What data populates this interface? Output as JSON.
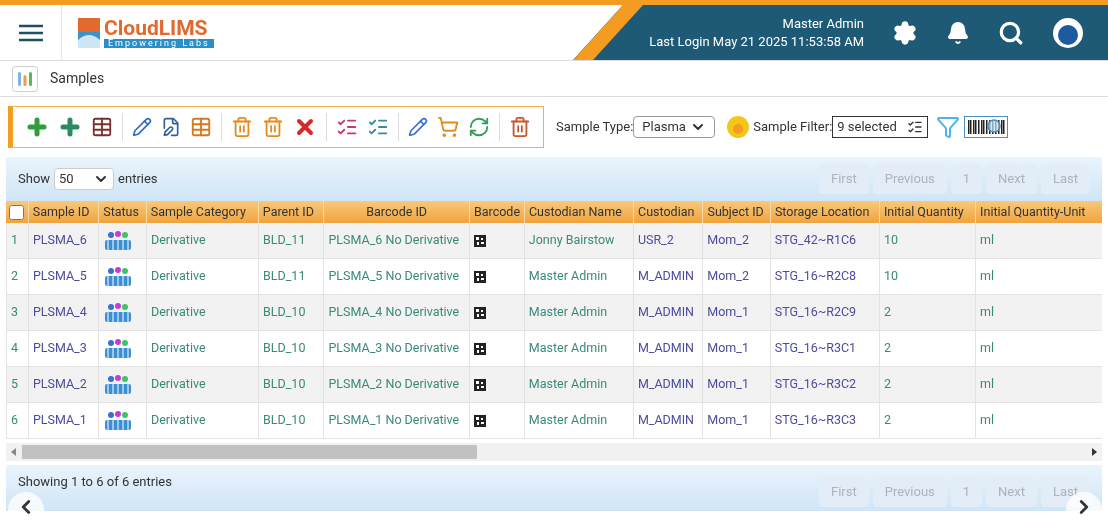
{
  "header": {
    "user": "Master Admin",
    "last_login": "Last  Login May 21 2025 11:53:58 AM"
  },
  "logo": {
    "name": "CloudLIMS",
    "tagline": "Empowering Labs"
  },
  "breadcrumb": {
    "title": "Samples"
  },
  "filters": {
    "sample_type_label": "Sample Type:",
    "sample_type_value": "Plasma",
    "sample_filter_label": "Sample Filter:",
    "sample_filter_value": "9 selected"
  },
  "table": {
    "show_label": "Show",
    "page_length": "50",
    "entries_label": "entries",
    "select_all_checked": false,
    "pagination_top": [
      {
        "label": "First",
        "disabled": true
      },
      {
        "label": "Previous",
        "disabled": true
      },
      {
        "label": "1",
        "disabled": true
      },
      {
        "label": "Next",
        "disabled": true
      },
      {
        "label": "Last",
        "disabled": true
      }
    ],
    "columns": [
      "Sample ID",
      "Status",
      "Sample Category",
      "Parent ID",
      "Barcode ID",
      "Barcode",
      "Custodian Name",
      "Custodian",
      "Subject ID",
      "Storage Location",
      "Initial Quantity",
      "Initial Quantity-Unit"
    ],
    "rows": [
      {
        "index": "1",
        "sample_id": "PLSMA_6",
        "category": "Derivative",
        "parent_id": "BLD_11",
        "barcode_id": "PLSMA_6 No Derivative",
        "custodian_name": "Jonny Bairstow",
        "custodian": "USR_2",
        "subject_id": "Mom_2",
        "storage_location": "STG_42~R1C6",
        "initial_quantity": "10",
        "unit": "ml"
      },
      {
        "index": "2",
        "sample_id": "PLSMA_5",
        "category": "Derivative",
        "parent_id": "BLD_11",
        "barcode_id": "PLSMA_5 No Derivative",
        "custodian_name": "Master Admin",
        "custodian": "M_ADMIN",
        "subject_id": "Mom_2",
        "storage_location": "STG_16~R2C8",
        "initial_quantity": "10",
        "unit": "ml"
      },
      {
        "index": "3",
        "sample_id": "PLSMA_4",
        "category": "Derivative",
        "parent_id": "BLD_10",
        "barcode_id": "PLSMA_4 No Derivative",
        "custodian_name": "Master Admin",
        "custodian": "M_ADMIN",
        "subject_id": "Mom_1",
        "storage_location": "STG_16~R2C9",
        "initial_quantity": "2",
        "unit": "ml"
      },
      {
        "index": "4",
        "sample_id": "PLSMA_3",
        "category": "Derivative",
        "parent_id": "BLD_10",
        "barcode_id": "PLSMA_3 No Derivative",
        "custodian_name": "Master Admin",
        "custodian": "M_ADMIN",
        "subject_id": "Mom_1",
        "storage_location": "STG_16~R3C1",
        "initial_quantity": "2",
        "unit": "ml"
      },
      {
        "index": "5",
        "sample_id": "PLSMA_2",
        "category": "Derivative",
        "parent_id": "BLD_10",
        "barcode_id": "PLSMA_2 No Derivative",
        "custodian_name": "Master Admin",
        "custodian": "M_ADMIN",
        "subject_id": "Mom_1",
        "storage_location": "STG_16~R3C2",
        "initial_quantity": "2",
        "unit": "ml"
      },
      {
        "index": "6",
        "sample_id": "PLSMA_1",
        "category": "Derivative",
        "parent_id": "BLD_10",
        "barcode_id": "PLSMA_1 No Derivative",
        "custodian_name": "Master Admin",
        "custodian": "M_ADMIN",
        "subject_id": "Mom_1",
        "storage_location": "STG_16~R3C3",
        "initial_quantity": "2",
        "unit": "ml"
      }
    ],
    "info": "Showing 1 to 6 of 6 entries",
    "pagination_bottom": [
      {
        "label": "First",
        "disabled": true
      },
      {
        "label": "Previous",
        "disabled": true
      },
      {
        "label": "1",
        "disabled": true
      },
      {
        "label": "Next",
        "disabled": true
      },
      {
        "label": "Last",
        "disabled": true
      }
    ]
  }
}
